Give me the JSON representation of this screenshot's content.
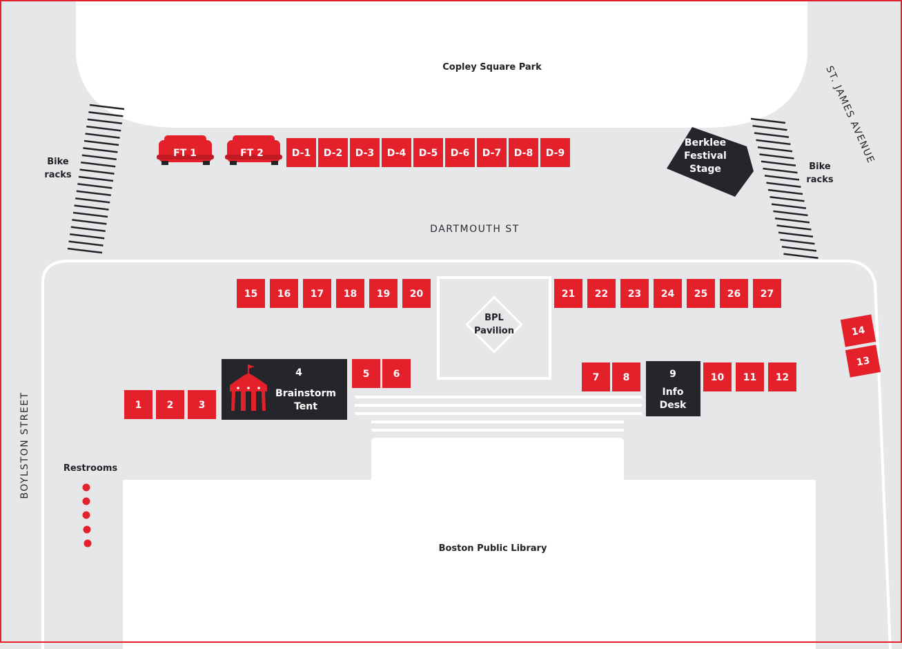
{
  "colors": {
    "ground": "#e6e7e9",
    "booth": "#e4212b",
    "dark": "#25262b",
    "border": "#e4212b",
    "building": "#ffffff"
  },
  "streets": {
    "dartmouth": "DARTMOUTH ST",
    "boylston": "BOYLSTON STREET",
    "st_james": "ST. JAMES AVENUE"
  },
  "places": {
    "copley_park": "Copley Square Park",
    "library": "Boston Public Library",
    "restrooms": "Restrooms",
    "bike_racks_left": [
      "Bike",
      "racks"
    ],
    "bike_racks_right": [
      "Bike",
      "racks"
    ],
    "pavilion": [
      "BPL",
      "Pavilion"
    ],
    "stage": [
      "Berklee",
      "Festival",
      "Stage"
    ]
  },
  "food_trucks": [
    "FT 1",
    "FT 2"
  ],
  "d_booths": [
    "D-1",
    "D-2",
    "D-3",
    "D-4",
    "D-5",
    "D-6",
    "D-7",
    "D-8",
    "D-9"
  ],
  "booths_upper_left": [
    "15",
    "16",
    "17",
    "18",
    "19",
    "20"
  ],
  "booths_upper_right": [
    "21",
    "22",
    "23",
    "24",
    "25",
    "26",
    "27"
  ],
  "booths_left": [
    "1",
    "2",
    "3"
  ],
  "booths_mid": [
    "5",
    "6"
  ],
  "booths_right_a": [
    "7",
    "8"
  ],
  "booths_right_b": [
    "10",
    "11",
    "12"
  ],
  "booths_edge": [
    "14",
    "13"
  ],
  "tent": {
    "number": "4",
    "label": [
      "Brainstorm",
      "Tent"
    ],
    "icon": "tent-icon"
  },
  "info_desk": {
    "number": "9",
    "label": [
      "Info",
      "Desk"
    ]
  }
}
